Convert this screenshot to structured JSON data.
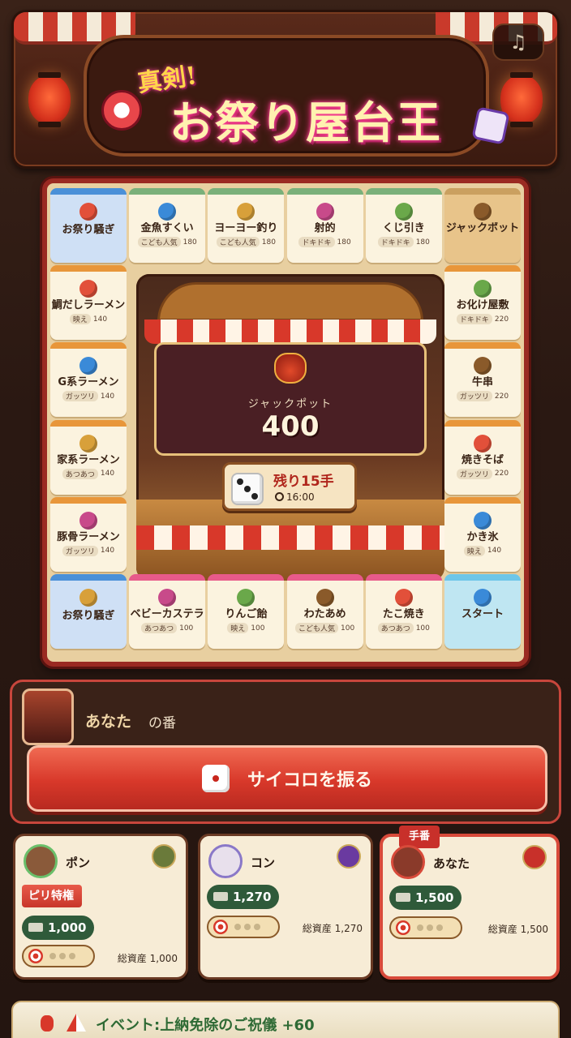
{
  "header": {
    "title_small": "真剣!",
    "title_main": "お祭り屋台王",
    "music_icon": "music-note-icon",
    "music_glyph": "♫"
  },
  "board": {
    "top_row": [
      {
        "name": "お祭り騒ぎ",
        "kind": "special"
      },
      {
        "name": "金魚すくい",
        "tag": "こども人気",
        "price": "180"
      },
      {
        "name": "ヨーヨー釣り",
        "tag": "こども人気",
        "price": "180"
      },
      {
        "name": "射的",
        "tag": "ドキドキ",
        "price": "180"
      },
      {
        "name": "くじ引き",
        "tag": "ドキドキ",
        "price": "180"
      },
      {
        "name": "ジャックポット",
        "kind": "jackpot"
      }
    ],
    "left_col": [
      {
        "name": "鯛だしラーメン",
        "tag": "映え",
        "price": "140"
      },
      {
        "name": "G系ラーメン",
        "tag": "ガッツリ",
        "price": "140"
      },
      {
        "name": "家系ラーメン",
        "tag": "あつあつ",
        "price": "140"
      },
      {
        "name": "豚骨ラーメン",
        "tag": "ガッツリ",
        "price": "140"
      }
    ],
    "right_col": [
      {
        "name": "お化け屋敷",
        "tag": "ドキドキ",
        "price": "220"
      },
      {
        "name": "牛串",
        "tag": "ガッツリ",
        "price": "220"
      },
      {
        "name": "焼きそば",
        "tag": "ガッツリ",
        "price": "220"
      },
      {
        "name": "かき氷",
        "tag": "映え",
        "price": "140"
      }
    ],
    "bottom_row": [
      {
        "name": "お祭り騒ぎ",
        "kind": "special"
      },
      {
        "name": "ベビーカステラ",
        "tag": "あつあつ",
        "price": "100"
      },
      {
        "name": "りんご飴",
        "tag": "映え",
        "price": "100"
      },
      {
        "name": "わたあめ",
        "tag": "こども人気",
        "price": "100"
      },
      {
        "name": "たこ焼き",
        "tag": "あつあつ",
        "price": "100"
      },
      {
        "name": "スタート",
        "kind": "start"
      }
    ],
    "jackpot_label": "ジャックポット",
    "jackpot_value": "400",
    "turns_left": "残り15手",
    "timer": "16:00"
  },
  "turn": {
    "player_name": "あなた",
    "suffix": "の番",
    "roll_button": "サイコロを振る"
  },
  "players": [
    {
      "name": "ポン",
      "privilege": "ピリ特権",
      "money": "1,000",
      "assets": "総資産 1,000",
      "dots_filled": 0,
      "ring": "#6abf6a",
      "face": "#8a5a3a",
      "badge": "#6a7a3a"
    },
    {
      "name": "コン",
      "money": "1,270",
      "assets": "総資産 1,270",
      "dots_filled": 0,
      "ring": "#8a78c8",
      "face": "#e8e0ec",
      "badge": "#6a3aa0"
    },
    {
      "name": "あなた",
      "money": "1,500",
      "assets": "総資産 1,500",
      "dots_filled": 0,
      "ring": "#d84a3a",
      "face": "#8a3a2a",
      "badge": "#c8302a",
      "turn_tag": "手番",
      "active": true
    }
  ],
  "event": {
    "text": "イベント:上納免除のご祝儀 +60"
  }
}
